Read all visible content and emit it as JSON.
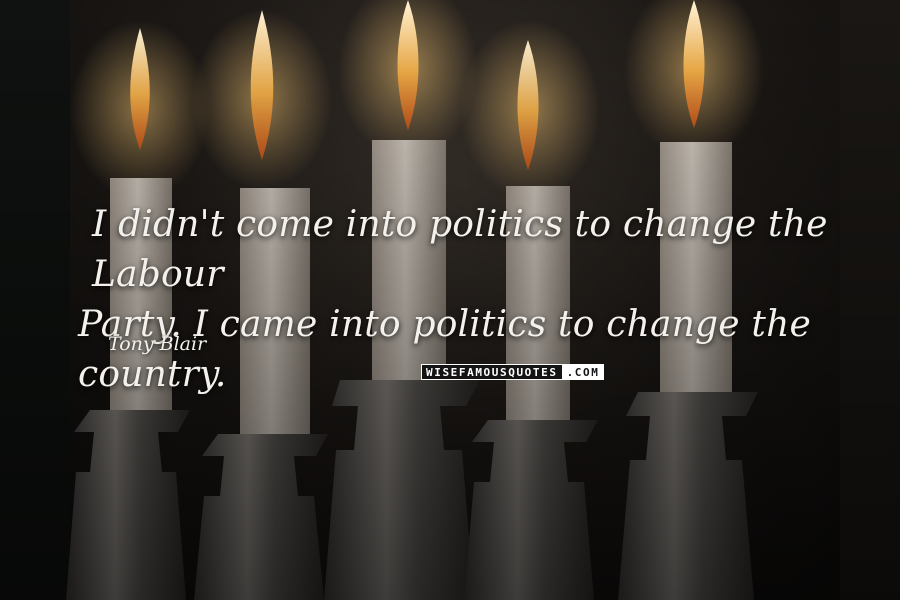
{
  "quote": {
    "line1": "I didn't come into politics to change the Labour",
    "line2": "Party. I came into politics to change the country."
  },
  "author": "Tony Blair",
  "watermark": {
    "main": "WISEFAMOUSQUOTES",
    "tld": ".COM"
  },
  "colors": {
    "text": "#f4f1ec",
    "flame": "#f6b24a",
    "candle": "#cfc6bb",
    "holder": "#6e6a66"
  }
}
